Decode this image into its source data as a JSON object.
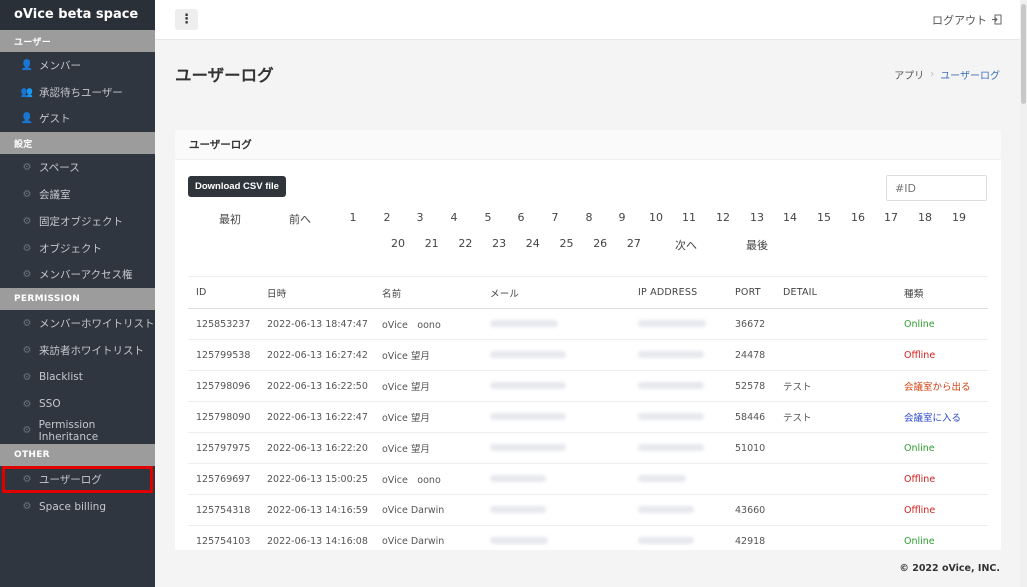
{
  "sidebar": {
    "brand": "oVice beta space",
    "sections": [
      {
        "title": "ユーザー",
        "items": [
          {
            "label": "メンバー",
            "icon": "person-icon"
          },
          {
            "label": "承認待ちユーザー",
            "icon": "user-plus-icon"
          },
          {
            "label": "ゲスト",
            "icon": "guest-icon"
          }
        ]
      },
      {
        "title": "設定",
        "items": [
          {
            "label": "スペース",
            "icon": "gear-icon"
          },
          {
            "label": "会議室",
            "icon": "gear-icon"
          },
          {
            "label": "固定オブジェクト",
            "icon": "gear-icon"
          },
          {
            "label": "オブジェクト",
            "icon": "gear-icon"
          },
          {
            "label": "メンバーアクセス権",
            "icon": "gear-icon"
          }
        ]
      },
      {
        "title": "PERMISSION",
        "items": [
          {
            "label": "メンバーホワイトリスト",
            "icon": "gear-icon"
          },
          {
            "label": "来訪者ホワイトリスト",
            "icon": "gear-icon"
          },
          {
            "label": "Blacklist",
            "icon": "gear-icon"
          },
          {
            "label": "SSO",
            "icon": "gear-icon"
          },
          {
            "label": "Permission Inheritance",
            "icon": "gear-icon"
          }
        ]
      },
      {
        "title": "OTHER",
        "items": [
          {
            "label": "ユーザーログ",
            "icon": "gear-icon",
            "active": true
          },
          {
            "label": "Space billing",
            "icon": "gear-icon"
          }
        ]
      }
    ]
  },
  "topbar": {
    "logout_label": "ログアウト"
  },
  "header": {
    "title": "ユーザーログ",
    "breadcrumb_root": "アプリ",
    "breadcrumb_current": "ユーザーログ"
  },
  "card": {
    "title": "ユーザーログ",
    "csv_button": "Download CSV file",
    "id_placeholder": "#ID",
    "pager": {
      "first": "最初",
      "prev": "前へ",
      "next": "次へ",
      "last": "最後",
      "pages": [
        "1",
        "2",
        "3",
        "4",
        "5",
        "6",
        "7",
        "8",
        "9",
        "10",
        "11",
        "12",
        "13",
        "14",
        "15",
        "16",
        "17",
        "18",
        "19",
        "20",
        "21",
        "22",
        "23",
        "24",
        "25",
        "26",
        "27"
      ]
    },
    "columns": [
      "ID",
      "日時",
      "名前",
      "メール",
      "IP ADDRESS",
      "PORT",
      "DETAIL",
      "種類"
    ],
    "rows": [
      {
        "id": "125853237",
        "datetime": "2022-06-13 18:47:47",
        "name": "oVice　oono",
        "port": "36672",
        "detail": "",
        "kind": "Online",
        "kind_class": "k-online"
      },
      {
        "id": "125799538",
        "datetime": "2022-06-13 16:27:42",
        "name": "oVice 望月",
        "port": "24478",
        "detail": "",
        "kind": "Offline",
        "kind_class": "k-offline"
      },
      {
        "id": "125798096",
        "datetime": "2022-06-13 16:22:50",
        "name": "oVice 望月",
        "port": "52578",
        "detail": "テスト",
        "kind": "会議室から出る",
        "kind_class": "k-leave"
      },
      {
        "id": "125798090",
        "datetime": "2022-06-13 16:22:47",
        "name": "oVice 望月",
        "port": "58446",
        "detail": "テスト",
        "kind": "会議室に入る",
        "kind_class": "k-enter"
      },
      {
        "id": "125797975",
        "datetime": "2022-06-13 16:22:20",
        "name": "oVice 望月",
        "port": "51010",
        "detail": "",
        "kind": "Online",
        "kind_class": "k-online"
      },
      {
        "id": "125769697",
        "datetime": "2022-06-13 15:00:25",
        "name": "oVice　oono",
        "port": "",
        "detail": "",
        "kind": "Offline",
        "kind_class": "k-offline"
      },
      {
        "id": "125754318",
        "datetime": "2022-06-13 14:16:59",
        "name": "oVice Darwin",
        "port": "43660",
        "detail": "",
        "kind": "Offline",
        "kind_class": "k-offline"
      },
      {
        "id": "125754103",
        "datetime": "2022-06-13 14:16:08",
        "name": "oVice Darwin",
        "port": "42918",
        "detail": "",
        "kind": "Online",
        "kind_class": "k-online"
      }
    ]
  },
  "footer": {
    "copyright": "© 2022 oVice, INC."
  }
}
